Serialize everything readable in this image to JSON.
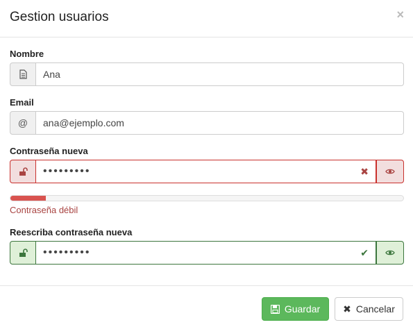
{
  "modal": {
    "title": "Gestion usuarios",
    "close_glyph": "×"
  },
  "fields": {
    "nombre": {
      "label": "Nombre",
      "value": "Ana",
      "icon": "document-icon"
    },
    "email": {
      "label": "Email",
      "value": "ana@ejemplo.com",
      "icon": "at-icon",
      "icon_glyph": "@"
    },
    "new_password": {
      "label": "Contraseña nueva",
      "value": "•••••••••",
      "state": "error",
      "feedback_glyph": "✖"
    },
    "repeat_password": {
      "label": "Reescriba contraseña nueva",
      "value": "•••••••••",
      "state": "success",
      "feedback_glyph": "✔"
    }
  },
  "strength": {
    "text": "Contraseña débil",
    "level": 0.09,
    "color": "#d9534f"
  },
  "footer": {
    "save_label": "Guardar",
    "cancel_label": "Cancelar"
  },
  "colors": {
    "error": "#a94442",
    "success": "#3c763d",
    "primary_green": "#5cb85c"
  }
}
